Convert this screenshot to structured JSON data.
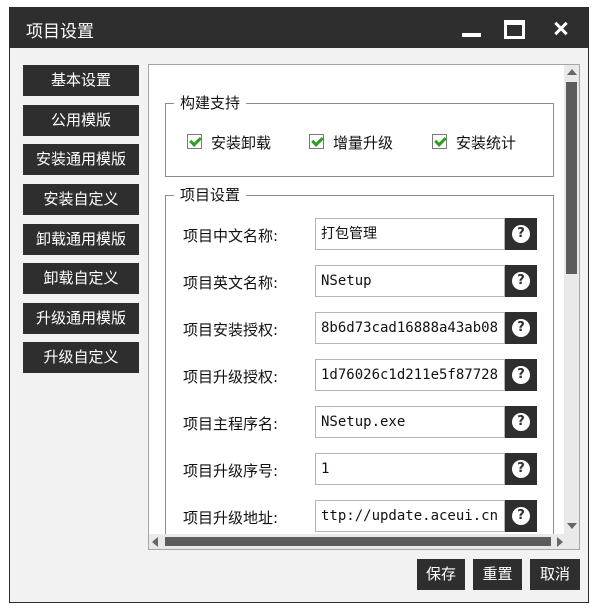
{
  "window": {
    "title": "项目设置"
  },
  "sidebar": {
    "items": [
      {
        "label": "基本设置"
      },
      {
        "label": "公用模版"
      },
      {
        "label": "安装通用模版"
      },
      {
        "label": "安装自定义"
      },
      {
        "label": "卸载通用模版"
      },
      {
        "label": "卸载自定义"
      },
      {
        "label": "升级通用模版"
      },
      {
        "label": "升级自定义"
      }
    ]
  },
  "build_support": {
    "title": "构建支持",
    "options": [
      {
        "label": "安装卸载",
        "checked": true
      },
      {
        "label": "增量升级",
        "checked": true
      },
      {
        "label": "安装统计",
        "checked": true
      }
    ]
  },
  "project_settings": {
    "title": "项目设置",
    "fields": [
      {
        "label": "项目中文名称:",
        "value": "打包管理"
      },
      {
        "label": "项目英文名称:",
        "value": "NSetup"
      },
      {
        "label": "项目安装授权:",
        "value": "8b6d73cad16888a43ab08"
      },
      {
        "label": "项目升级授权:",
        "value": "1d76026c1d211e5f87728"
      },
      {
        "label": "项目主程序名:",
        "value": "NSetup.exe"
      },
      {
        "label": "项目升级序号:",
        "value": "1"
      },
      {
        "label": "项目升级地址:",
        "value": "ttp://update.aceui.cn"
      }
    ],
    "help_glyph": "?"
  },
  "footer": {
    "save_label": "保存",
    "reset_label": "重置",
    "cancel_label": "取消"
  },
  "icons": [
    "minimize-icon",
    "maximize-icon",
    "close-icon",
    "checkmark-icon",
    "help-icon"
  ],
  "colors": {
    "titlebar": "#2e2e2e",
    "button_bg": "#2e2e2e",
    "button_text": "#ffffff",
    "checkmark": "#29a01f"
  }
}
